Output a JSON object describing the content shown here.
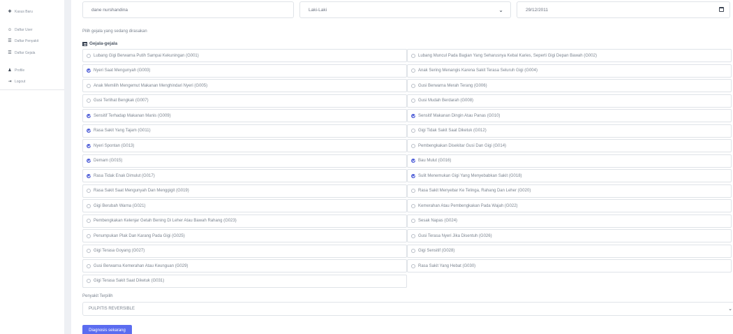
{
  "sidebar": {
    "items": [
      {
        "label": "Kasus Baru",
        "icon": "clipboard-icon",
        "glyph": "✚"
      },
      {
        "label": "Daftar User",
        "icon": "users-icon",
        "glyph": "☺"
      },
      {
        "label": "Daftar Penyakit",
        "icon": "list-icon",
        "glyph": "☰"
      },
      {
        "label": "Daftar Gejala",
        "icon": "list-icon",
        "glyph": "☰"
      },
      {
        "label": "Profile",
        "icon": "user-icon",
        "glyph": "♟"
      },
      {
        "label": "Logout",
        "icon": "logout-icon",
        "glyph": "⇥"
      }
    ]
  },
  "form": {
    "name_value": "dane nurshandina",
    "gender_value": "Laki-Laki",
    "date_value": "29/12/2011"
  },
  "symptoms_hint": "Pilih gejala yang sedang dirasakan",
  "symptoms_title": "Gejala-gejala",
  "symptoms": [
    {
      "label": "Lubang Gigi Berwarna Putih Sampai Kekuningan (G001)",
      "checked": false
    },
    {
      "label": "Lubang Muncul Pada Bagian Yang Seharusnya Kebal Karies, Seperti Gigi Depan Bawah (G002)",
      "checked": false
    },
    {
      "label": "Nyeri Saat Mengunyah (G003)",
      "checked": true
    },
    {
      "label": "Anak Sering Menangis Karena Sakit Terasa Seluruh Gigi (G004)",
      "checked": false
    },
    {
      "label": "Anak Memilih Mengemut Makanan Menghindari Nyeri (G005)",
      "checked": false
    },
    {
      "label": "Gusi Berwarna Merah Terang (G006)",
      "checked": false
    },
    {
      "label": "Gusi Terlihat Bengkak (G007)",
      "checked": false
    },
    {
      "label": "Gusi Mudah Berdarah (G008)",
      "checked": false
    },
    {
      "label": "Sensitif Terhadap Makanan Manis (G009)",
      "checked": true
    },
    {
      "label": "Sensitif Makanan Dingin Atau Panas (G010)",
      "checked": true
    },
    {
      "label": "Rasa Sakit Yang Tajam (G011)",
      "checked": true
    },
    {
      "label": "Gigi Tidak Sakit Saat Diketuk (G012)",
      "checked": false
    },
    {
      "label": "Nyeri Spontan (G013)",
      "checked": true
    },
    {
      "label": "Pembengkakan Disekitar Gusi Dan Gigi (G014)",
      "checked": false
    },
    {
      "label": "Demam (G015)",
      "checked": true
    },
    {
      "label": "Bau Mulut (G016)",
      "checked": true
    },
    {
      "label": "Rasa Tidak Enak Dimulut (G017)",
      "checked": true
    },
    {
      "label": "Sulit Menemukan Gigi Yang Menyebabkan Sakit (G018)",
      "checked": true
    },
    {
      "label": "Rasa Sakit Saat Mengunyah Dan Menggigit (G019)",
      "checked": false
    },
    {
      "label": "Rasa Sakit Menyebar Ke Telinga, Rahang Dan Leher (G020)",
      "checked": false
    },
    {
      "label": "Gigi Berubah Warna (G021)",
      "checked": false
    },
    {
      "label": "Kemerahan Atau Pembengkakan Pada Wajah (G022)",
      "checked": false
    },
    {
      "label": "Pembengkakan Kelenjar Getah Bening Di Leher Atau Bawah Rahang (G023)",
      "checked": false
    },
    {
      "label": "Sesak Napas (G024)",
      "checked": false
    },
    {
      "label": "Penumpukan Plak Dan Karang Pada Gigi (G025)",
      "checked": false
    },
    {
      "label": "Gusi Terasa Nyeri Jika Disentuh (G026)",
      "checked": false
    },
    {
      "label": "Gigi Terasa Goyang (G027)",
      "checked": false
    },
    {
      "label": "Gigi Sensitif (G028)",
      "checked": false
    },
    {
      "label": "Gusi Berwarna Kemerahan Atau Keunguan (G029)",
      "checked": false
    },
    {
      "label": "Rasa Sakit Yang Hebat (G030)",
      "checked": false
    },
    {
      "label": "Gigi Terasa Sakit Saat Diketuk (G031)",
      "checked": false
    }
  ],
  "disease": {
    "label": "Penyakit Terpilih",
    "value": "PULPITIS REVERSIBLE"
  },
  "diagnose_button": "Diagnosis sekarang",
  "colors": {
    "accent": "#5b6cf0",
    "checked": "#4f5fd8",
    "border": "#dfe3e8",
    "text": "#7b8490"
  }
}
